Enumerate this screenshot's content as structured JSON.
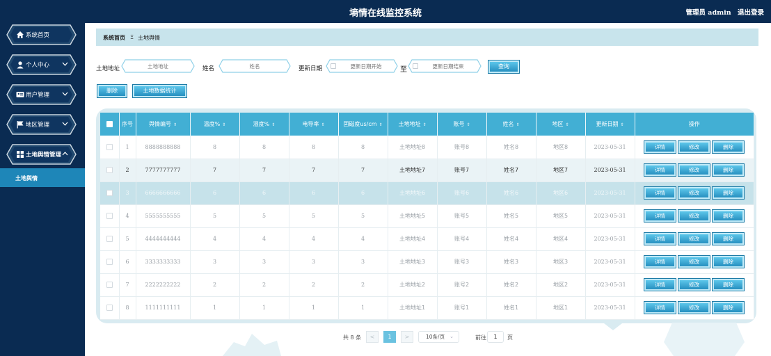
{
  "header": {
    "title": "墒情在线监控系统",
    "user_label": "管理员 admin",
    "logout_label": "退出登录"
  },
  "sidebar": {
    "items": [
      {
        "label": "系统首页",
        "icon": "home-icon"
      },
      {
        "label": "个人中心",
        "icon": "user-icon"
      },
      {
        "label": "用户管理",
        "icon": "id-card-icon"
      },
      {
        "label": "地区管理",
        "icon": "flag-icon"
      },
      {
        "label": "土地舆情管理",
        "icon": "grid-icon"
      }
    ],
    "sub_active": "土地舆情"
  },
  "breadcrumb": {
    "home": "系统首页",
    "separator": "Ξ",
    "current": "土地舆情"
  },
  "search": {
    "address_label": "土地地址",
    "address_placeholder": "土地地址",
    "name_label": "姓名",
    "name_placeholder": "姓名",
    "date_label": "更新日期",
    "date_start_placeholder": "更新日期开始",
    "date_to": "至",
    "date_end_placeholder": "更新日期结束",
    "query_button": "查询"
  },
  "actions": {
    "delete_button": "删除",
    "stats_button": "土地数据统计"
  },
  "table": {
    "columns": [
      "序号",
      "舆情编号",
      "温度%",
      "湿度%",
      "电导率",
      "固磁度us/cm",
      "土地地址",
      "账号",
      "姓名",
      "地区",
      "更新日期",
      "操作"
    ],
    "sortable": [
      false,
      true,
      true,
      true,
      true,
      true,
      true,
      true,
      true,
      true,
      true,
      false
    ],
    "sort_glyph": "⇕",
    "row_buttons": [
      "详情",
      "修改",
      "删除"
    ],
    "rows": [
      {
        "no": "1",
        "code": "8888888888",
        "temp": "8",
        "humidity": "8",
        "conductivity": "8",
        "magnetism": "8",
        "address": "土地地址8",
        "account": "账号8",
        "name": "姓名8",
        "region": "地区8",
        "date": "2023-05-31"
      },
      {
        "no": "2",
        "code": "7777777777",
        "temp": "7",
        "humidity": "7",
        "conductivity": "7",
        "magnetism": "7",
        "address": "土地地址7",
        "account": "账号7",
        "name": "姓名7",
        "region": "地区7",
        "date": "2023-05-31"
      },
      {
        "no": "3",
        "code": "6666666666",
        "temp": "6",
        "humidity": "6",
        "conductivity": "6",
        "magnetism": "6",
        "address": "土地地址6",
        "account": "账号6",
        "name": "姓名6",
        "region": "地区6",
        "date": "2023-05-31"
      },
      {
        "no": "4",
        "code": "5555555555",
        "temp": "5",
        "humidity": "5",
        "conductivity": "5",
        "magnetism": "5",
        "address": "土地地址5",
        "account": "账号5",
        "name": "姓名5",
        "region": "地区5",
        "date": "2023-05-31"
      },
      {
        "no": "5",
        "code": "4444444444",
        "temp": "4",
        "humidity": "4",
        "conductivity": "4",
        "magnetism": "4",
        "address": "土地地址4",
        "account": "账号4",
        "name": "姓名4",
        "region": "地区4",
        "date": "2023-05-31"
      },
      {
        "no": "6",
        "code": "3333333333",
        "temp": "3",
        "humidity": "3",
        "conductivity": "3",
        "magnetism": "3",
        "address": "土地地址3",
        "account": "账号3",
        "name": "姓名3",
        "region": "地区3",
        "date": "2023-05-31"
      },
      {
        "no": "7",
        "code": "2222222222",
        "temp": "2",
        "humidity": "2",
        "conductivity": "2",
        "magnetism": "2",
        "address": "土地地址2",
        "account": "账号2",
        "name": "姓名2",
        "region": "地区2",
        "date": "2023-05-31"
      },
      {
        "no": "8",
        "code": "1111111111",
        "temp": "1",
        "humidity": "1",
        "conductivity": "1",
        "magnetism": "1",
        "address": "土地地址1",
        "account": "账号1",
        "name": "姓名1",
        "region": "地区1",
        "date": "2023-05-31"
      }
    ]
  },
  "pagination": {
    "total_text": "共 8 条",
    "prev": "<",
    "current_page": "1",
    "next": ">",
    "page_size": "10条/页",
    "goto_label": "前往",
    "goto_value": "1",
    "goto_unit": "页"
  },
  "colors": {
    "navy": "#0a2b52",
    "accent": "#42afd4",
    "button": "#2d9ccc",
    "breadcrumb_bg": "#c8e4ec"
  }
}
